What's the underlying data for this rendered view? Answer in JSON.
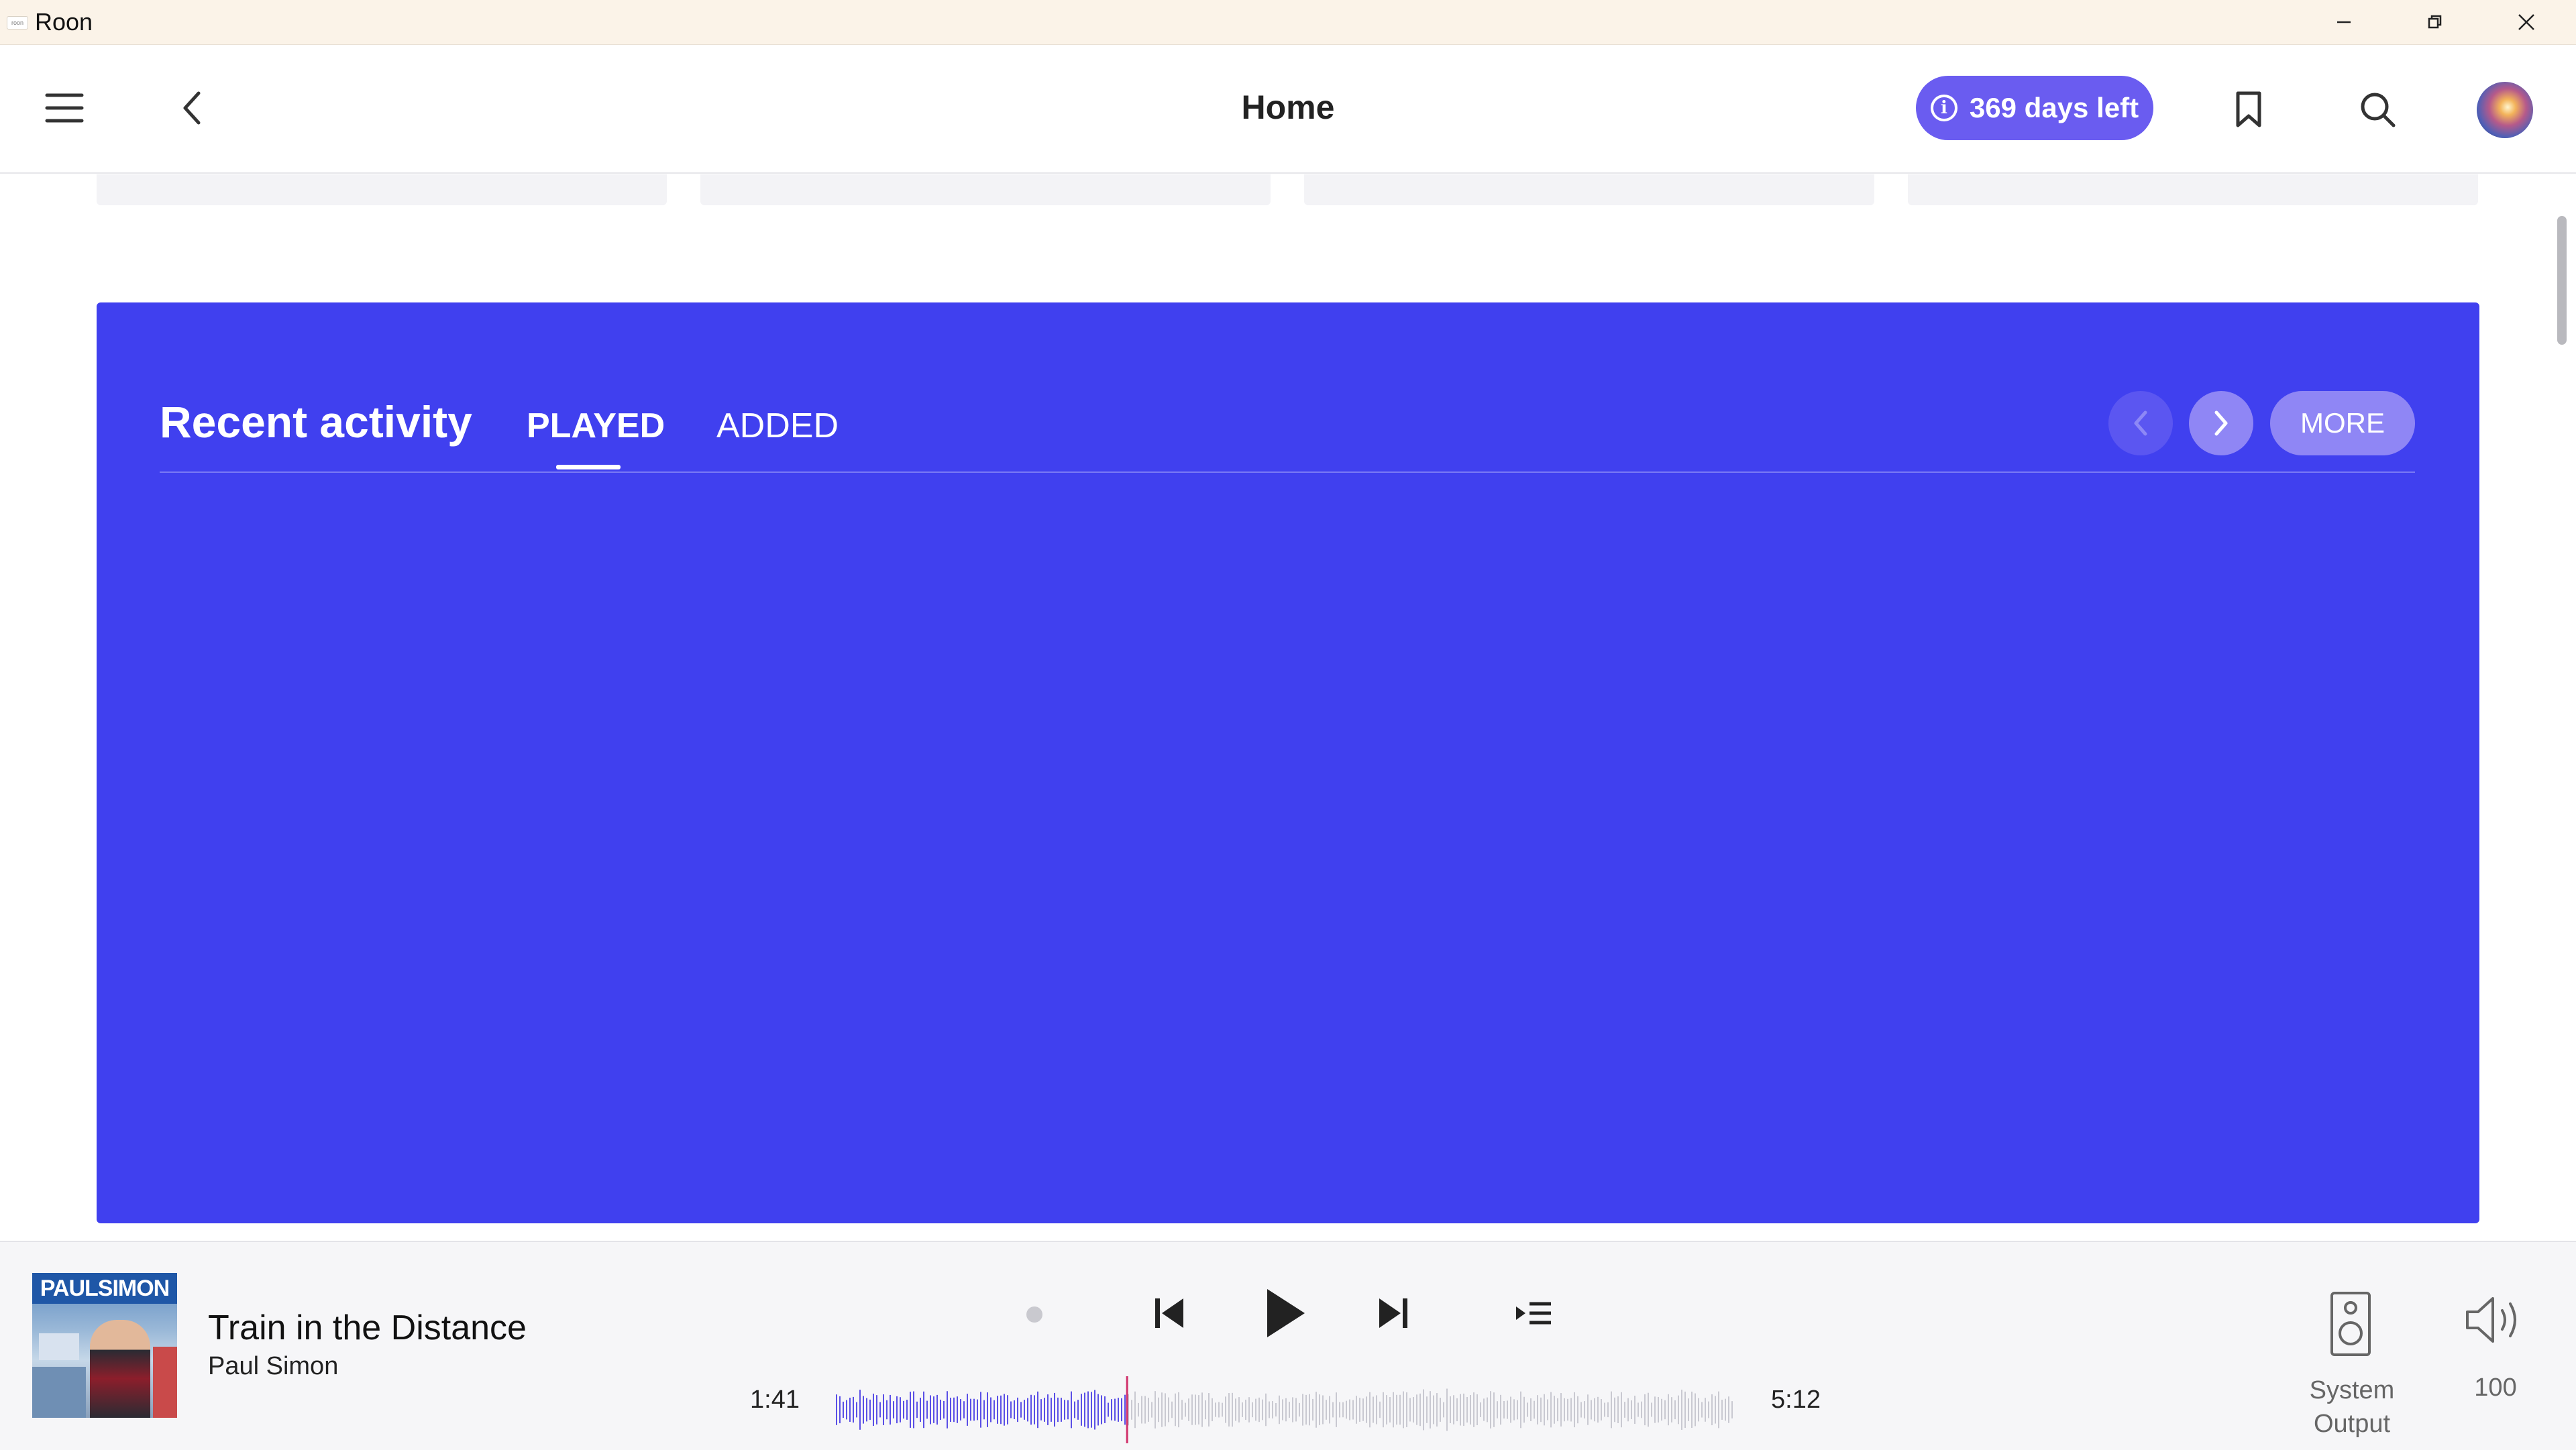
{
  "window": {
    "icon_text": "roon",
    "title": "Roon"
  },
  "topbar": {
    "page_title": "Home",
    "trial_badge": "369 days left",
    "icons": [
      "menu-icon",
      "back-icon",
      "bookmark-icon",
      "search-icon",
      "avatar"
    ]
  },
  "recent_activity": {
    "title": "Recent activity",
    "tabs": [
      {
        "label": "PLAYED",
        "active": true
      },
      {
        "label": "ADDED",
        "active": false
      }
    ],
    "more_label": "MORE",
    "background_color": "#4040ef"
  },
  "now_playing": {
    "album_text": "PAULSIMON",
    "track_title": "Train in the Distance",
    "artist": "Paul Simon",
    "elapsed": "1:41",
    "duration": "5:12",
    "progress": 0.324,
    "output_label_line1": "System",
    "output_label_line2": "Output",
    "volume": "100"
  },
  "colors": {
    "accent": "#6a5cf0",
    "played_waveform": "#5a4fe6",
    "playhead": "#d0306a"
  }
}
